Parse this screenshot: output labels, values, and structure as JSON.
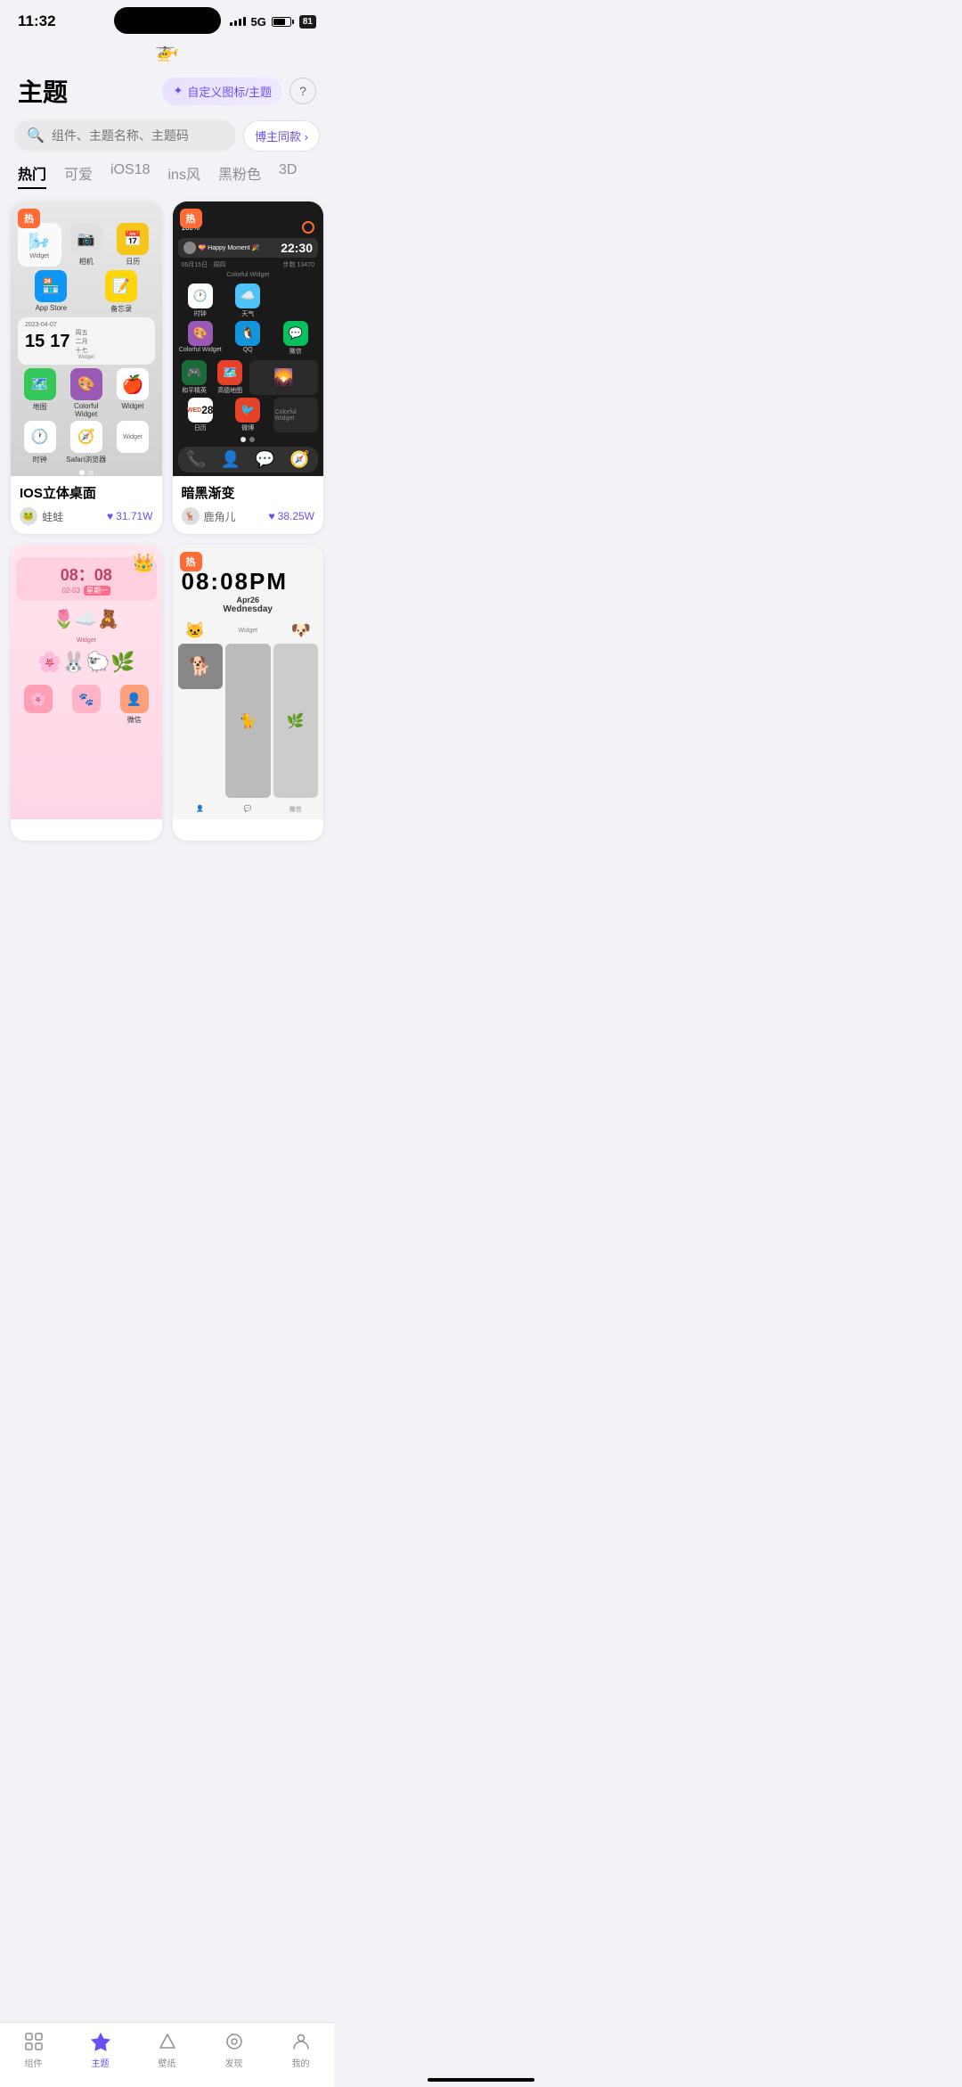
{
  "status": {
    "time": "11:32",
    "signal": "5G",
    "battery": 81
  },
  "header": {
    "title": "主题",
    "customize_label": "自定义图标/主题",
    "help_icon": "❓"
  },
  "search": {
    "placeholder": "组件、主题名称、主题码",
    "blogger_btn": "博主同款 ›"
  },
  "categories": [
    {
      "id": "hot",
      "label": "热门",
      "active": true
    },
    {
      "id": "cute",
      "label": "可爱",
      "active": false
    },
    {
      "id": "ios18",
      "label": "iOS18",
      "active": false
    },
    {
      "id": "ins",
      "label": "ins风",
      "active": false
    },
    {
      "id": "black",
      "label": "黑粉色",
      "active": false
    },
    {
      "id": "3d",
      "label": "3D",
      "active": false
    }
  ],
  "themes": [
    {
      "id": "ios-3d",
      "title": "IOS立体桌面",
      "hot": true,
      "author": "蛙蛙",
      "likes": "31.71W",
      "style": "ios"
    },
    {
      "id": "dark-gradient",
      "title": "暗黑渐变",
      "hot": true,
      "author": "鹿角儿",
      "likes": "38.25W",
      "style": "dark"
    },
    {
      "id": "cute-theme",
      "title": "",
      "hot": false,
      "crown": true,
      "author": "",
      "likes": "",
      "style": "cute"
    },
    {
      "id": "white-theme",
      "title": "",
      "hot": true,
      "author": "",
      "likes": "",
      "style": "white"
    }
  ],
  "bottom_nav": [
    {
      "id": "widget",
      "label": "组件",
      "icon": "⊞",
      "active": false
    },
    {
      "id": "theme",
      "label": "主题",
      "icon": "✦",
      "active": true
    },
    {
      "id": "wallpaper",
      "label": "壁纸",
      "icon": "△",
      "active": false
    },
    {
      "id": "discover",
      "label": "发现",
      "icon": "◎",
      "active": false
    },
    {
      "id": "mine",
      "label": "我的",
      "icon": "⊙",
      "active": false
    }
  ],
  "app_labels": {
    "widget": "Widget",
    "appstore": "App Store",
    "notes": "备忘录",
    "maps": "地图",
    "colorful_widget": "Colorful Widget",
    "clock": "时钟",
    "safari": "Safari浏览器",
    "qq": "QQ",
    "wechat": "微信",
    "calendar_cn": "日历",
    "weibo": "微博",
    "peace_elite": "和平精英",
    "gaode": "高德地图"
  }
}
